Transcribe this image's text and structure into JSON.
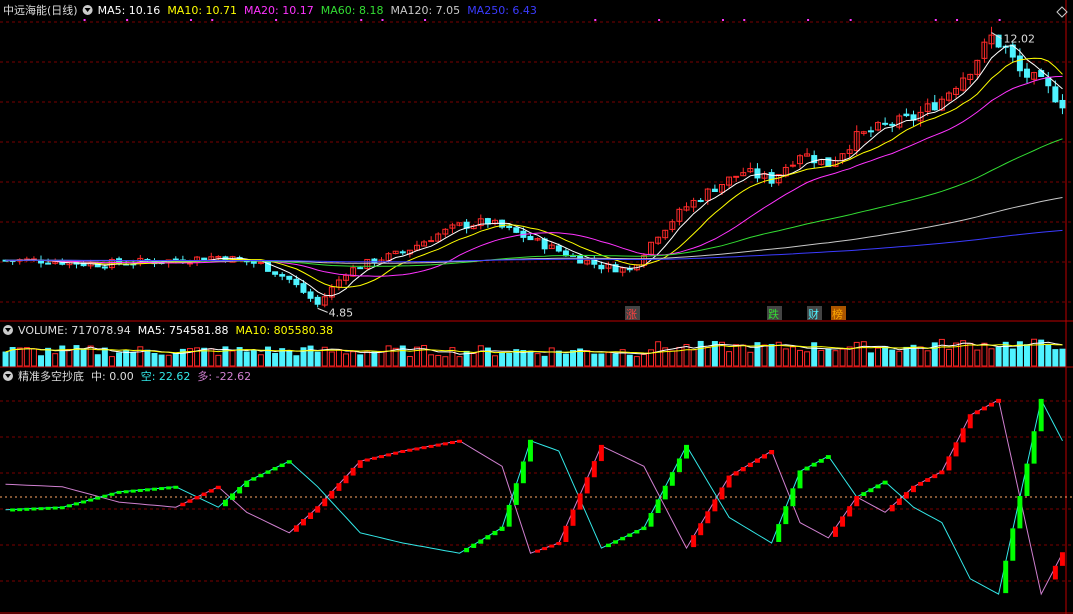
{
  "colors": {
    "bg": "#000000",
    "grid": "#7a0000",
    "up": "#ff2a2a",
    "down": "#4ff3ff",
    "ma5": "#ffffff",
    "ma10": "#ffff00",
    "ma20": "#ff33ff",
    "ma60": "#33dd33",
    "ma120": "#c8c8c8",
    "ma250": "#3b3bff",
    "indic_green": "#00ff00",
    "indic_red": "#ff0000",
    "line_cyan": "#33e8e8",
    "line_pink": "#d080d0",
    "mid_line": "#ffaa66"
  },
  "main_panel": {
    "title": "中远海能(日线)",
    "ma_labels": [
      {
        "label": "MA5: 10.16",
        "color": "#ffffff"
      },
      {
        "label": "MA10: 10.71",
        "color": "#ffff00"
      },
      {
        "label": "MA20: 10.17",
        "color": "#ff33ff"
      },
      {
        "label": "MA60: 8.18",
        "color": "#33dd33"
      },
      {
        "label": "MA120: 7.05",
        "color": "#c8c8c8"
      },
      {
        "label": "MA250: 6.43",
        "color": "#3b3bff"
      }
    ],
    "high_label": "12.02",
    "low_label": "4.85",
    "markers": [
      {
        "label": "涨",
        "color": "#ff4040",
        "box": "#444444"
      },
      {
        "label": "跌",
        "color": "#33dd33",
        "box": "#444444"
      },
      {
        "label": "财",
        "color": "#4ff3ff",
        "box": "#444444"
      },
      {
        "label": "榜",
        "color": "#ffaa00",
        "box": "#aa5500"
      }
    ]
  },
  "volume_panel": {
    "labels": [
      {
        "label": "VOLUME: 717078.94",
        "color": "#dddddd"
      },
      {
        "label": "MA5: 754581.88",
        "color": "#ffffff"
      },
      {
        "label": "MA10: 805580.38",
        "color": "#ffff00"
      }
    ]
  },
  "indicator_panel": {
    "labels": [
      {
        "label": "精准多空抄底",
        "color": "#dddddd"
      },
      {
        "label": "中: 0.00",
        "color": "#dddddd"
      },
      {
        "label": "空: 22.62",
        "color": "#33e8e8"
      },
      {
        "label": "多: -22.62",
        "color": "#d080d0"
      }
    ]
  },
  "chart_data": {
    "type": "candlestick",
    "count": 150,
    "price_range": [
      4.6,
      12.4
    ],
    "high": 12.02,
    "low": 4.85,
    "anchors": [
      [
        0,
        6.1
      ],
      [
        6,
        6.1
      ],
      [
        12,
        6.0
      ],
      [
        18,
        6.05
      ],
      [
        24,
        6.1
      ],
      [
        30,
        6.2
      ],
      [
        36,
        6.0
      ],
      [
        40,
        5.6
      ],
      [
        44,
        4.95
      ],
      [
        48,
        5.8
      ],
      [
        52,
        6.1
      ],
      [
        56,
        6.3
      ],
      [
        60,
        6.7
      ],
      [
        64,
        7.0
      ],
      [
        68,
        7.1
      ],
      [
        72,
        6.8
      ],
      [
        76,
        6.5
      ],
      [
        80,
        6.2
      ],
      [
        84,
        5.95
      ],
      [
        88,
        5.85
      ],
      [
        92,
        6.8
      ],
      [
        96,
        7.5
      ],
      [
        100,
        8.0
      ],
      [
        104,
        8.4
      ],
      [
        108,
        8.2
      ],
      [
        112,
        8.9
      ],
      [
        116,
        8.6
      ],
      [
        120,
        9.3
      ],
      [
        124,
        9.6
      ],
      [
        128,
        9.8
      ],
      [
        132,
        10.3
      ],
      [
        136,
        11.1
      ],
      [
        139,
        11.9
      ],
      [
        141,
        11.6
      ],
      [
        143,
        11.0
      ],
      [
        146,
        10.7
      ],
      [
        149,
        10.2
      ]
    ],
    "ma_final": {
      "MA5": 10.16,
      "MA10": 10.71,
      "MA20": 10.17,
      "MA60": 8.18,
      "MA120": 7.05,
      "MA250": 6.43
    },
    "indicator": {
      "mid": 0.0,
      "kong": 22.62,
      "duo": -22.62,
      "range": [
        -45,
        45
      ],
      "anchors": [
        [
          0,
          5
        ],
        [
          8,
          4
        ],
        [
          16,
          -2
        ],
        [
          24,
          -4
        ],
        [
          30,
          4
        ],
        [
          34,
          -6
        ],
        [
          40,
          -14
        ],
        [
          44,
          -4
        ],
        [
          50,
          14
        ],
        [
          56,
          18
        ],
        [
          64,
          22
        ],
        [
          70,
          12
        ],
        [
          74,
          -22
        ],
        [
          78,
          -18
        ],
        [
          84,
          20
        ],
        [
          90,
          12
        ],
        [
          96,
          -20
        ],
        [
          102,
          8
        ],
        [
          108,
          18
        ],
        [
          112,
          -10
        ],
        [
          116,
          -16
        ],
        [
          120,
          0
        ],
        [
          124,
          -6
        ],
        [
          128,
          4
        ],
        [
          132,
          10
        ],
        [
          136,
          32
        ],
        [
          140,
          38
        ],
        [
          143,
          0
        ],
        [
          146,
          -38
        ],
        [
          149,
          -22
        ]
      ]
    }
  }
}
